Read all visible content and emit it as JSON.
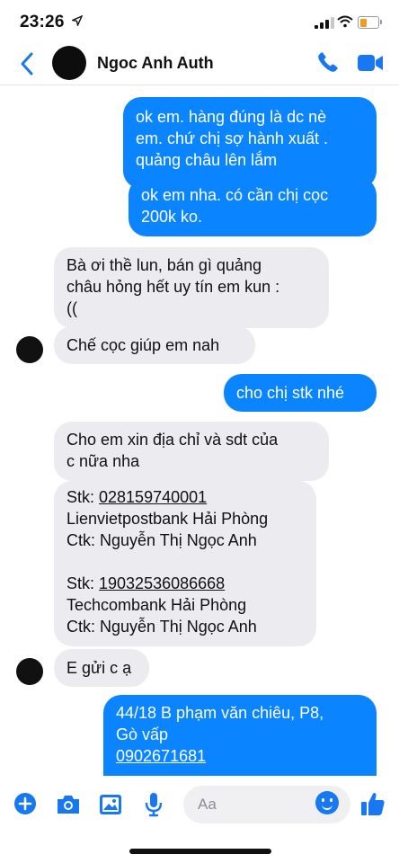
{
  "status_bar": {
    "time": "23:26",
    "battery_color": "#f29c1f"
  },
  "header": {
    "contact_name": "Ngoc Anh Auth"
  },
  "messages": [
    {
      "side": "out",
      "lines": [
        "ok em. hàng đúng là dc nè",
        "em. chứ chị sợ hành xuất .",
        "quảng châu lên lắm"
      ]
    },
    {
      "side": "out",
      "lines": [
        "ok em nha. có cần chị cọc",
        "200k ko."
      ]
    },
    {
      "side": "in",
      "lines": [
        "Bà ơi thề lun, bán gì quảng",
        "châu hỏng hết uy tín em kun :",
        "(("
      ]
    },
    {
      "side": "in",
      "lines": [
        "Chế cọc giúp em nah"
      ]
    },
    {
      "side": "out",
      "lines": [
        "cho chị stk nhé"
      ]
    },
    {
      "side": "in",
      "lines": [
        "Cho em xin địa chỉ và sdt của",
        "c nữa nha"
      ]
    },
    {
      "side": "in",
      "stk_label": "Stk: ",
      "account1": "028159740001",
      "bank1": "Lienvietpostbank Hải Phòng",
      "owner1": "Ctk: Nguyễn Thị Ngọc Anh",
      "account2": "19032536086668",
      "bank2": "Techcombank Hải Phòng",
      "owner2": "Ctk: Nguyễn Thị Ngọc Anh"
    },
    {
      "side": "in",
      "lines": [
        "E gửi c ạ"
      ]
    },
    {
      "side": "out",
      "lines": [
        "44/18 B phạm văn chiêu, P8,",
        "Gò vấp"
      ],
      "phone": "0902671681"
    }
  ],
  "composer": {
    "placeholder": "Aa"
  },
  "colors": {
    "accent": "#1877f2",
    "outgoing_bubble": "#0a84ff",
    "incoming_bubble": "#ececf0"
  },
  "icons": [
    "back-chevron-icon",
    "phone-icon",
    "video-camera-icon",
    "plus-icon",
    "camera-icon",
    "photo-icon",
    "microphone-icon",
    "emoji-icon",
    "thumbs-up-icon"
  ]
}
